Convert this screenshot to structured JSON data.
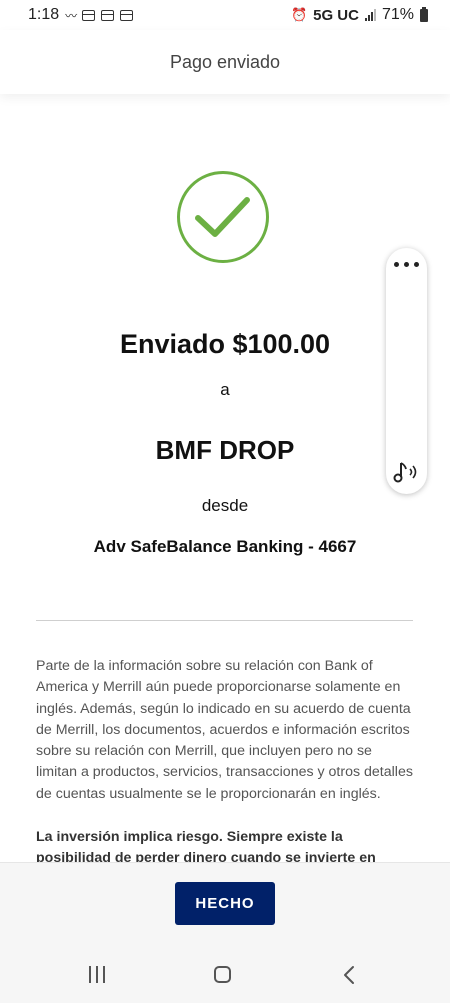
{
  "status_bar": {
    "time": "1:18",
    "network": "5G UC",
    "battery": "71%"
  },
  "header": {
    "title": "Pago enviado"
  },
  "confirmation": {
    "amount_text": "Enviado $100.00",
    "to_word": "a",
    "payee": "BMF DROP",
    "from_word": "desde",
    "account": "Adv SafeBalance Banking - 4667",
    "success_color": "#6cb043"
  },
  "disclaimer": {
    "text": "Parte de la información sobre su relación con Bank of America y Merrill aún puede proporcionarse solamente en inglés. Además, según lo indicado en su acuerdo de cuenta de Merrill, los documentos, acuerdos e información escritos sobre su relación con Merrill, que incluyen pero no se limitan a productos, servicios, transacciones y otros detalles de cuentas usualmente se le proporcionarán en inglés.",
    "risk_text": "La inversión implica riesgo. Siempre existe la posibilidad de perder dinero cuando se invierte en"
  },
  "footer": {
    "done_label": "HECHO",
    "button_color": "#012169"
  },
  "floating_panel": {
    "icons": [
      "more-dots-icon",
      "audio-icon"
    ]
  },
  "nav_bar": {
    "icons": [
      "recents-icon",
      "home-icon",
      "back-icon"
    ]
  }
}
